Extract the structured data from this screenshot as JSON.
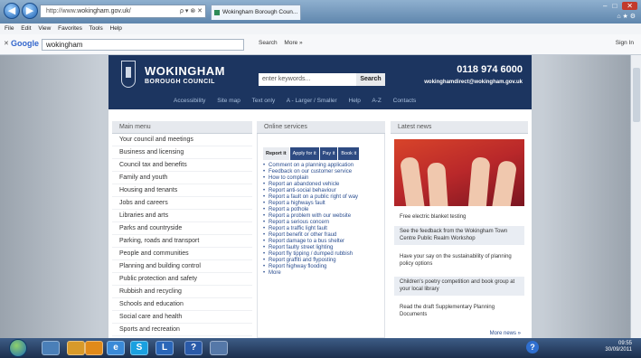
{
  "browser": {
    "url_prefix": "http://www.",
    "url": "wokingham.gov.uk/",
    "address_controls": "ρ ▾ ⊗ ✕",
    "tab_title": "Wokingham Borough Coun...",
    "menu": [
      "File",
      "Edit",
      "View",
      "Favorites",
      "Tools",
      "Help"
    ]
  },
  "google_toolbar": {
    "close": "✕",
    "logo": "Google",
    "query": "wokingham",
    "search_label": "Search",
    "more_label": "More »",
    "sign_in": "Sign In"
  },
  "site": {
    "name": "WOKINGHAM",
    "subtitle": "BOROUGH COUNCIL",
    "search_placeholder": "enter keywords...",
    "search_button": "Search",
    "phone": "0118 974 6000",
    "email": "wokinghamdirect@wokingham.gov.uk",
    "top_links": [
      "Accessibility",
      "Site map",
      "Text only",
      "A - Larger / Smaller",
      "Help",
      "A-Z",
      "Contacts"
    ]
  },
  "main_menu": {
    "heading": "Main menu",
    "items": [
      "Your council and meetings",
      "Business and licensing",
      "Council tax and benefits",
      "Family and youth",
      "Housing and tenants",
      "Jobs and careers",
      "Libraries and arts",
      "Parks and countryside",
      "Parking, roads and transport",
      "People and communities",
      "Planning and building control",
      "Public protection and safety",
      "Rubbish and recycling",
      "Schools and education",
      "Social care and health",
      "Sports and recreation"
    ]
  },
  "online_services": {
    "heading": "Online services",
    "tabs": [
      "Report it",
      "Apply for it",
      "Pay it",
      "Book it"
    ],
    "links": [
      "Comment on a planning application",
      "Feedback on our customer service",
      "How to complain",
      "Report an abandoned vehicle",
      "Report anti-social behaviour",
      "Report a fault on a public right of way",
      "Report a highways fault",
      "Report a pothole",
      "Report a problem with our website",
      "Report a serious concern",
      "Report a traffic light fault",
      "Report benefit or other fraud",
      "Report damage to a bus shelter",
      "Report faulty street lighting",
      "Report fly tipping / dumped rubbish",
      "Report graffiti and flyposting",
      "Report highway flooding",
      "More"
    ]
  },
  "latest_news": {
    "heading": "Latest news",
    "items": [
      "Free electric blanket testing",
      "See the feedback from the Wokingham Town Centre Public Realm Workshop",
      "Have your say on the sustainability of planning policy options",
      "Children's poetry competition and book group at your local library",
      "Read the draft Supplementary Planning Documents"
    ],
    "more": "More news »"
  },
  "taskbar": {
    "apps": [
      "",
      "",
      "",
      "e",
      "S",
      "L",
      "?",
      ""
    ],
    "time": "09:55",
    "date": "30/09/2011",
    "help": "?"
  }
}
